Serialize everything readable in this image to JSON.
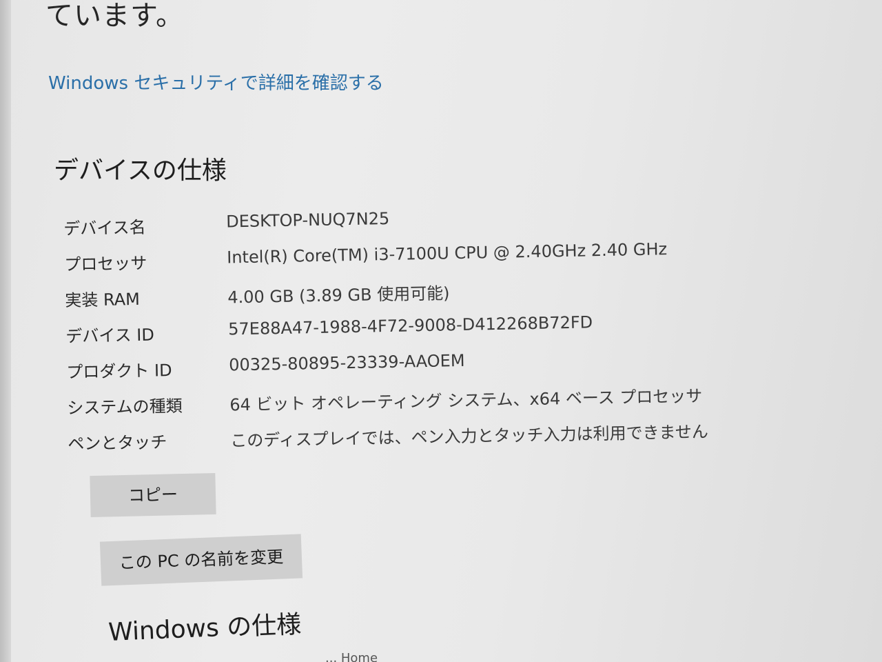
{
  "intro": {
    "tail_text": "ています。"
  },
  "security_link": {
    "label": "Windows セキュリティで詳細を確認する"
  },
  "device_specs": {
    "title": "デバイスの仕様",
    "rows": [
      {
        "label": "デバイス名",
        "value": "DESKTOP-NUQ7N25"
      },
      {
        "label": "プロセッサ",
        "value": "Intel(R) Core(TM) i3-7100U CPU @ 2.40GHz   2.40 GHz"
      },
      {
        "label": "実装 RAM",
        "value": "4.00 GB (3.89 GB 使用可能)"
      },
      {
        "label": "デバイス ID",
        "value": "57E88A47-1988-4F72-9008-D412268B72FD"
      },
      {
        "label": "プロダクト ID",
        "value": "00325-80895-23339-AAOEM"
      },
      {
        "label": "システムの種類",
        "value": "64 ビット オペレーティング システム、x64 ベース プロセッサ"
      },
      {
        "label": "ペンとタッチ",
        "value": "このディスプレイでは、ペン入力とタッチ入力は利用できません"
      }
    ],
    "copy_button": "コピー",
    "rename_button": "この PC の名前を変更"
  },
  "windows_specs": {
    "title": "Windows の仕様",
    "edition_fragment": "... Home"
  }
}
